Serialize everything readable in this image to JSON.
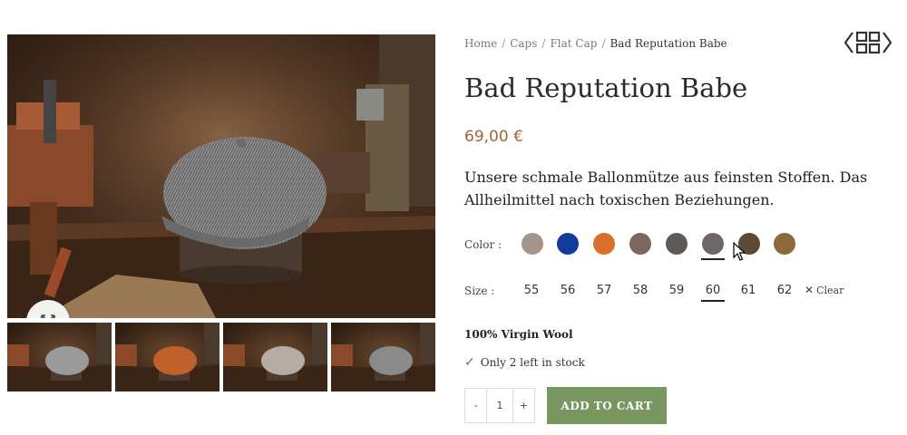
{
  "breadcrumb": {
    "items": [
      "Home",
      "Caps",
      "Flat Cap"
    ],
    "separator": "/",
    "current": "Bad Reputation Babe"
  },
  "product": {
    "title": "Bad Reputation Babe",
    "price": "69,00 €",
    "description": "Unsere schmale Ballonmütze aus feinsten Stoffen. Das Allheilmittel nach toxischen Beziehungen.",
    "material": "100% Virgin Wool",
    "stock": "Only 2 left in stock"
  },
  "variations": {
    "color_label": "Color :",
    "colors": [
      "#a5948a",
      "#123c9a",
      "#d9702a",
      "#7c6760",
      "#5e5a58",
      "#6d6866",
      "#5e4a34",
      "#8a6a3c"
    ],
    "selected_color_index": 5,
    "size_label": "Size :",
    "sizes": [
      "55",
      "56",
      "57",
      "58",
      "59",
      "60",
      "61",
      "62"
    ],
    "selected_size": "60",
    "clear_label": "Clear"
  },
  "cart": {
    "minus": "-",
    "quantity": "1",
    "plus": "+",
    "add_to_cart": "ADD TO CART"
  },
  "gallery": {
    "zoom_icon": "expand-arrows-icon",
    "thumb_cap_colors": [
      "#9a9a9a",
      "#c0602a",
      "#b5aca5",
      "#8a8a8a"
    ]
  },
  "icons": {
    "nav": "grid-nav-icon",
    "stock_check": "checkmark-icon",
    "clear": "close-icon"
  },
  "colors": {
    "price": "#a0643a",
    "button": "#7a9660",
    "check": "#8a5a3a"
  }
}
